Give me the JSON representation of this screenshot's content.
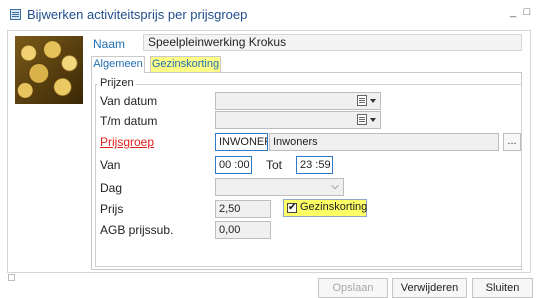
{
  "window": {
    "title": "Bijwerken activiteitsprijs per prijsgroep",
    "minimize": "_",
    "maximize": "□"
  },
  "header": {
    "naam_label": "Naam",
    "naam_value": "Speelpleinwerking Krokus"
  },
  "tabs": [
    {
      "label": "Algemeen",
      "active": true
    },
    {
      "label": "Gezinskorting",
      "active": false
    }
  ],
  "group": {
    "title": "Prijzen",
    "van_datum_label": "Van datum",
    "van_datum_value": "",
    "tm_datum_label": "T/m datum",
    "tm_datum_value": "",
    "prijsgroep_label": "Prijsgroep",
    "prijsgroep_code": "INWONERS",
    "prijsgroep_name": "Inwoners",
    "prijsgroep_button": "...",
    "van_label": "Van",
    "van_value": "00 :00",
    "tot_label": "Tot",
    "tot_value": "23 :59",
    "dag_label": "Dag",
    "dag_value": "",
    "prijs_label": "Prijs",
    "prijs_value": "2,50",
    "gezinskorting_label": "Gezinskorting",
    "gezinskorting_checked": true,
    "agb_label": "AGB prijssub.",
    "agb_value": "0,00"
  },
  "buttons": {
    "opslaan": "Opslaan",
    "verwijderen": "Verwijderen",
    "sluiten": "Sluiten"
  },
  "colors": {
    "title": "#1f4e8c",
    "link_blue": "#1f6fb2",
    "required_red": "#e0201b",
    "highlight_yellow": "#ffff66"
  },
  "icons": {
    "window": "window-icon",
    "calendar": "calendar-icon",
    "dropdown": "chevron-down-icon",
    "check": "checkmark-icon"
  }
}
